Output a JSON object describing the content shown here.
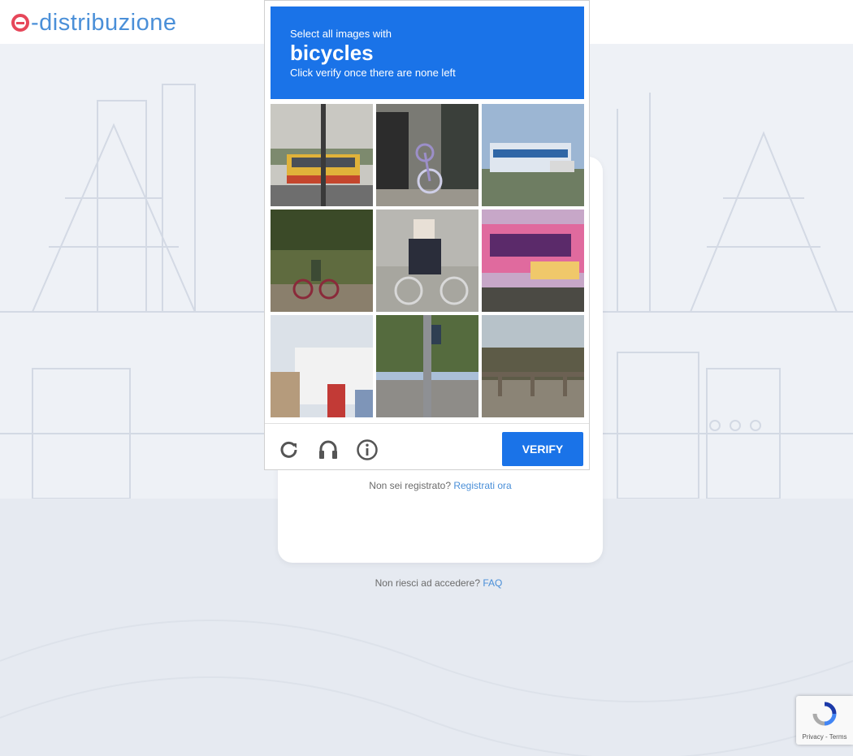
{
  "header": {
    "logo_text": "-distribuzione"
  },
  "captcha": {
    "instruction": "Select all images with",
    "target": "bicycles",
    "hint": "Click verify once there are none left",
    "verify_label": "VERIFY",
    "icons": [
      "reload-icon",
      "audio-icon",
      "info-icon"
    ],
    "tiles": [
      "bus-on-street",
      "bicycle-parked-by-fence",
      "bus-at-intersection",
      "cyclist-under-trees",
      "person-riding-bicycle",
      "sign-with-thai-text",
      "buildings-and-signals",
      "traffic-light-pole",
      "bridge-over-river"
    ]
  },
  "login": {
    "signup_prompt": "Non sei registrato?",
    "signup_link": "Registrati ora"
  },
  "footer": {
    "help_prompt": "Non riesci ad accedere?",
    "faq_link": "FAQ"
  },
  "recaptcha": {
    "terms": "Privacy - Terms"
  },
  "colors": {
    "brand_blue": "#4a8fd8",
    "brand_red": "#e6475a",
    "captcha_blue": "#1a73e8"
  }
}
